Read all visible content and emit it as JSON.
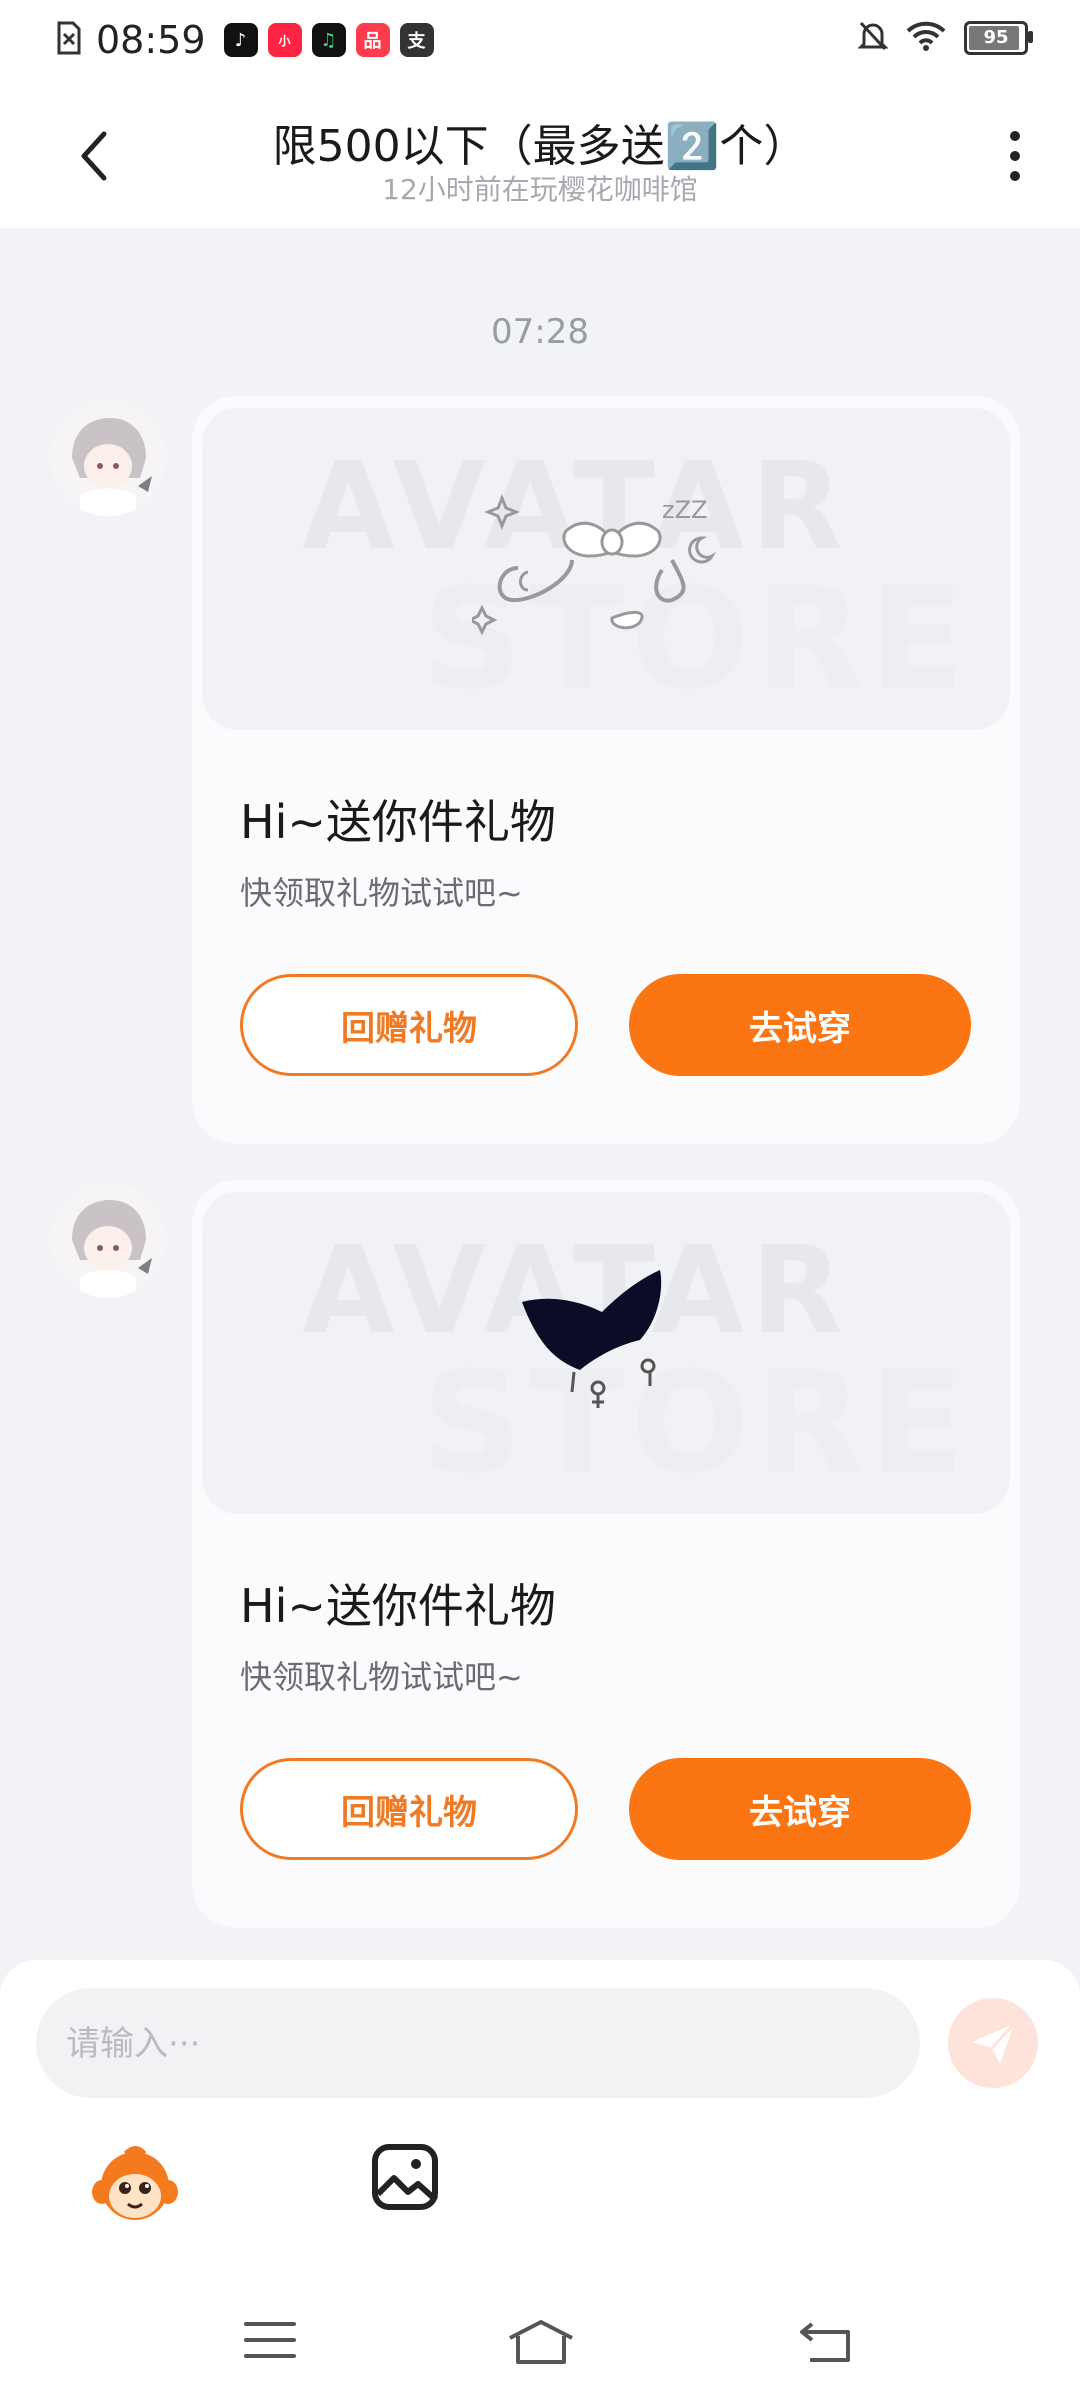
{
  "status_bar": {
    "time": "08:59",
    "battery": "95",
    "icons": [
      "sim-error-icon",
      "tiktok-icon",
      "xiaohongshu-icon",
      "music-icon",
      "shop-icon",
      "alipay-icon",
      "mute-icon",
      "wifi-icon",
      "battery-icon"
    ]
  },
  "header": {
    "title": "限500以下（最多送2️⃣个）",
    "subtitle": "12小时前在玩樱花咖啡馆"
  },
  "chat": {
    "timestamp": "07:28",
    "messages": [
      {
        "gift_icon": "bow-glasses-chain-icon",
        "title": "Hi~送你件礼物",
        "subtitle": "快领取礼物试试吧~",
        "return_gift_label": "回赠礼物",
        "try_on_label": "去试穿"
      },
      {
        "gift_icon": "black-bow-gender-charm-icon",
        "title": "Hi~送你件礼物",
        "subtitle": "快领取礼物试试吧~",
        "return_gift_label": "回赠礼物",
        "try_on_label": "去试穿"
      }
    ]
  },
  "input": {
    "placeholder": "请输入···"
  },
  "colors": {
    "accent": "#fb7512",
    "outline": "#f07a23",
    "background": "#f2f3f7"
  }
}
